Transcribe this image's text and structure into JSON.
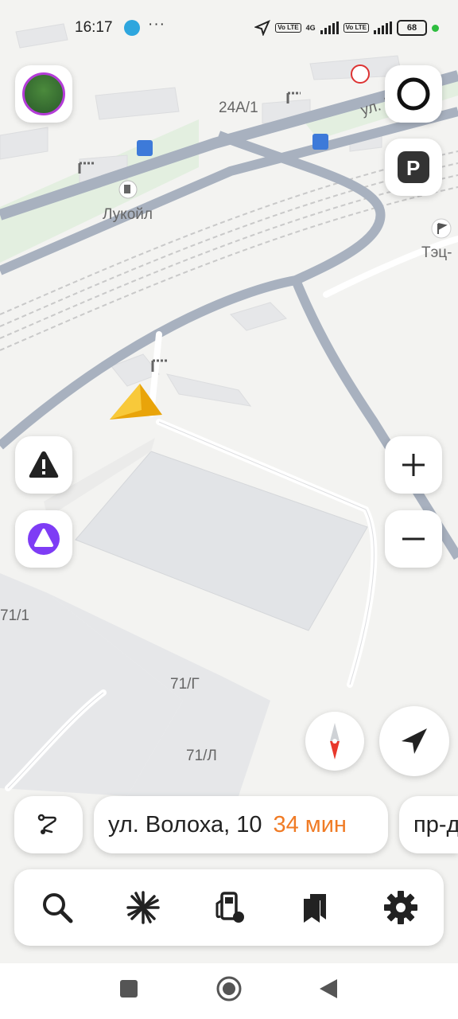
{
  "status_bar": {
    "time": "16:17",
    "dots": "···",
    "network": "4G",
    "volte": "Vo LTE",
    "battery": "68"
  },
  "map": {
    "labels": {
      "building_24a1": "24А/1",
      "street": "ул. Волоха",
      "lukoil": "Лукойл",
      "tets": "Тэц-",
      "b71_1": "71/1",
      "b71g": "71/Г",
      "b71l": "71/Л"
    }
  },
  "route_chips": [
    {
      "address": "ул. Волоха, 10",
      "eta": "34 мин"
    },
    {
      "address": "пр-д"
    }
  ],
  "toolbar": {
    "items": [
      "search",
      "discovery",
      "gas-station",
      "bookmarks",
      "settings"
    ]
  },
  "colors": {
    "accent_orange": "#f07b25",
    "alice_purple": "#7e3cf5",
    "arrow_yellow": "#f6b90f",
    "compass_red": "#e8382c"
  }
}
